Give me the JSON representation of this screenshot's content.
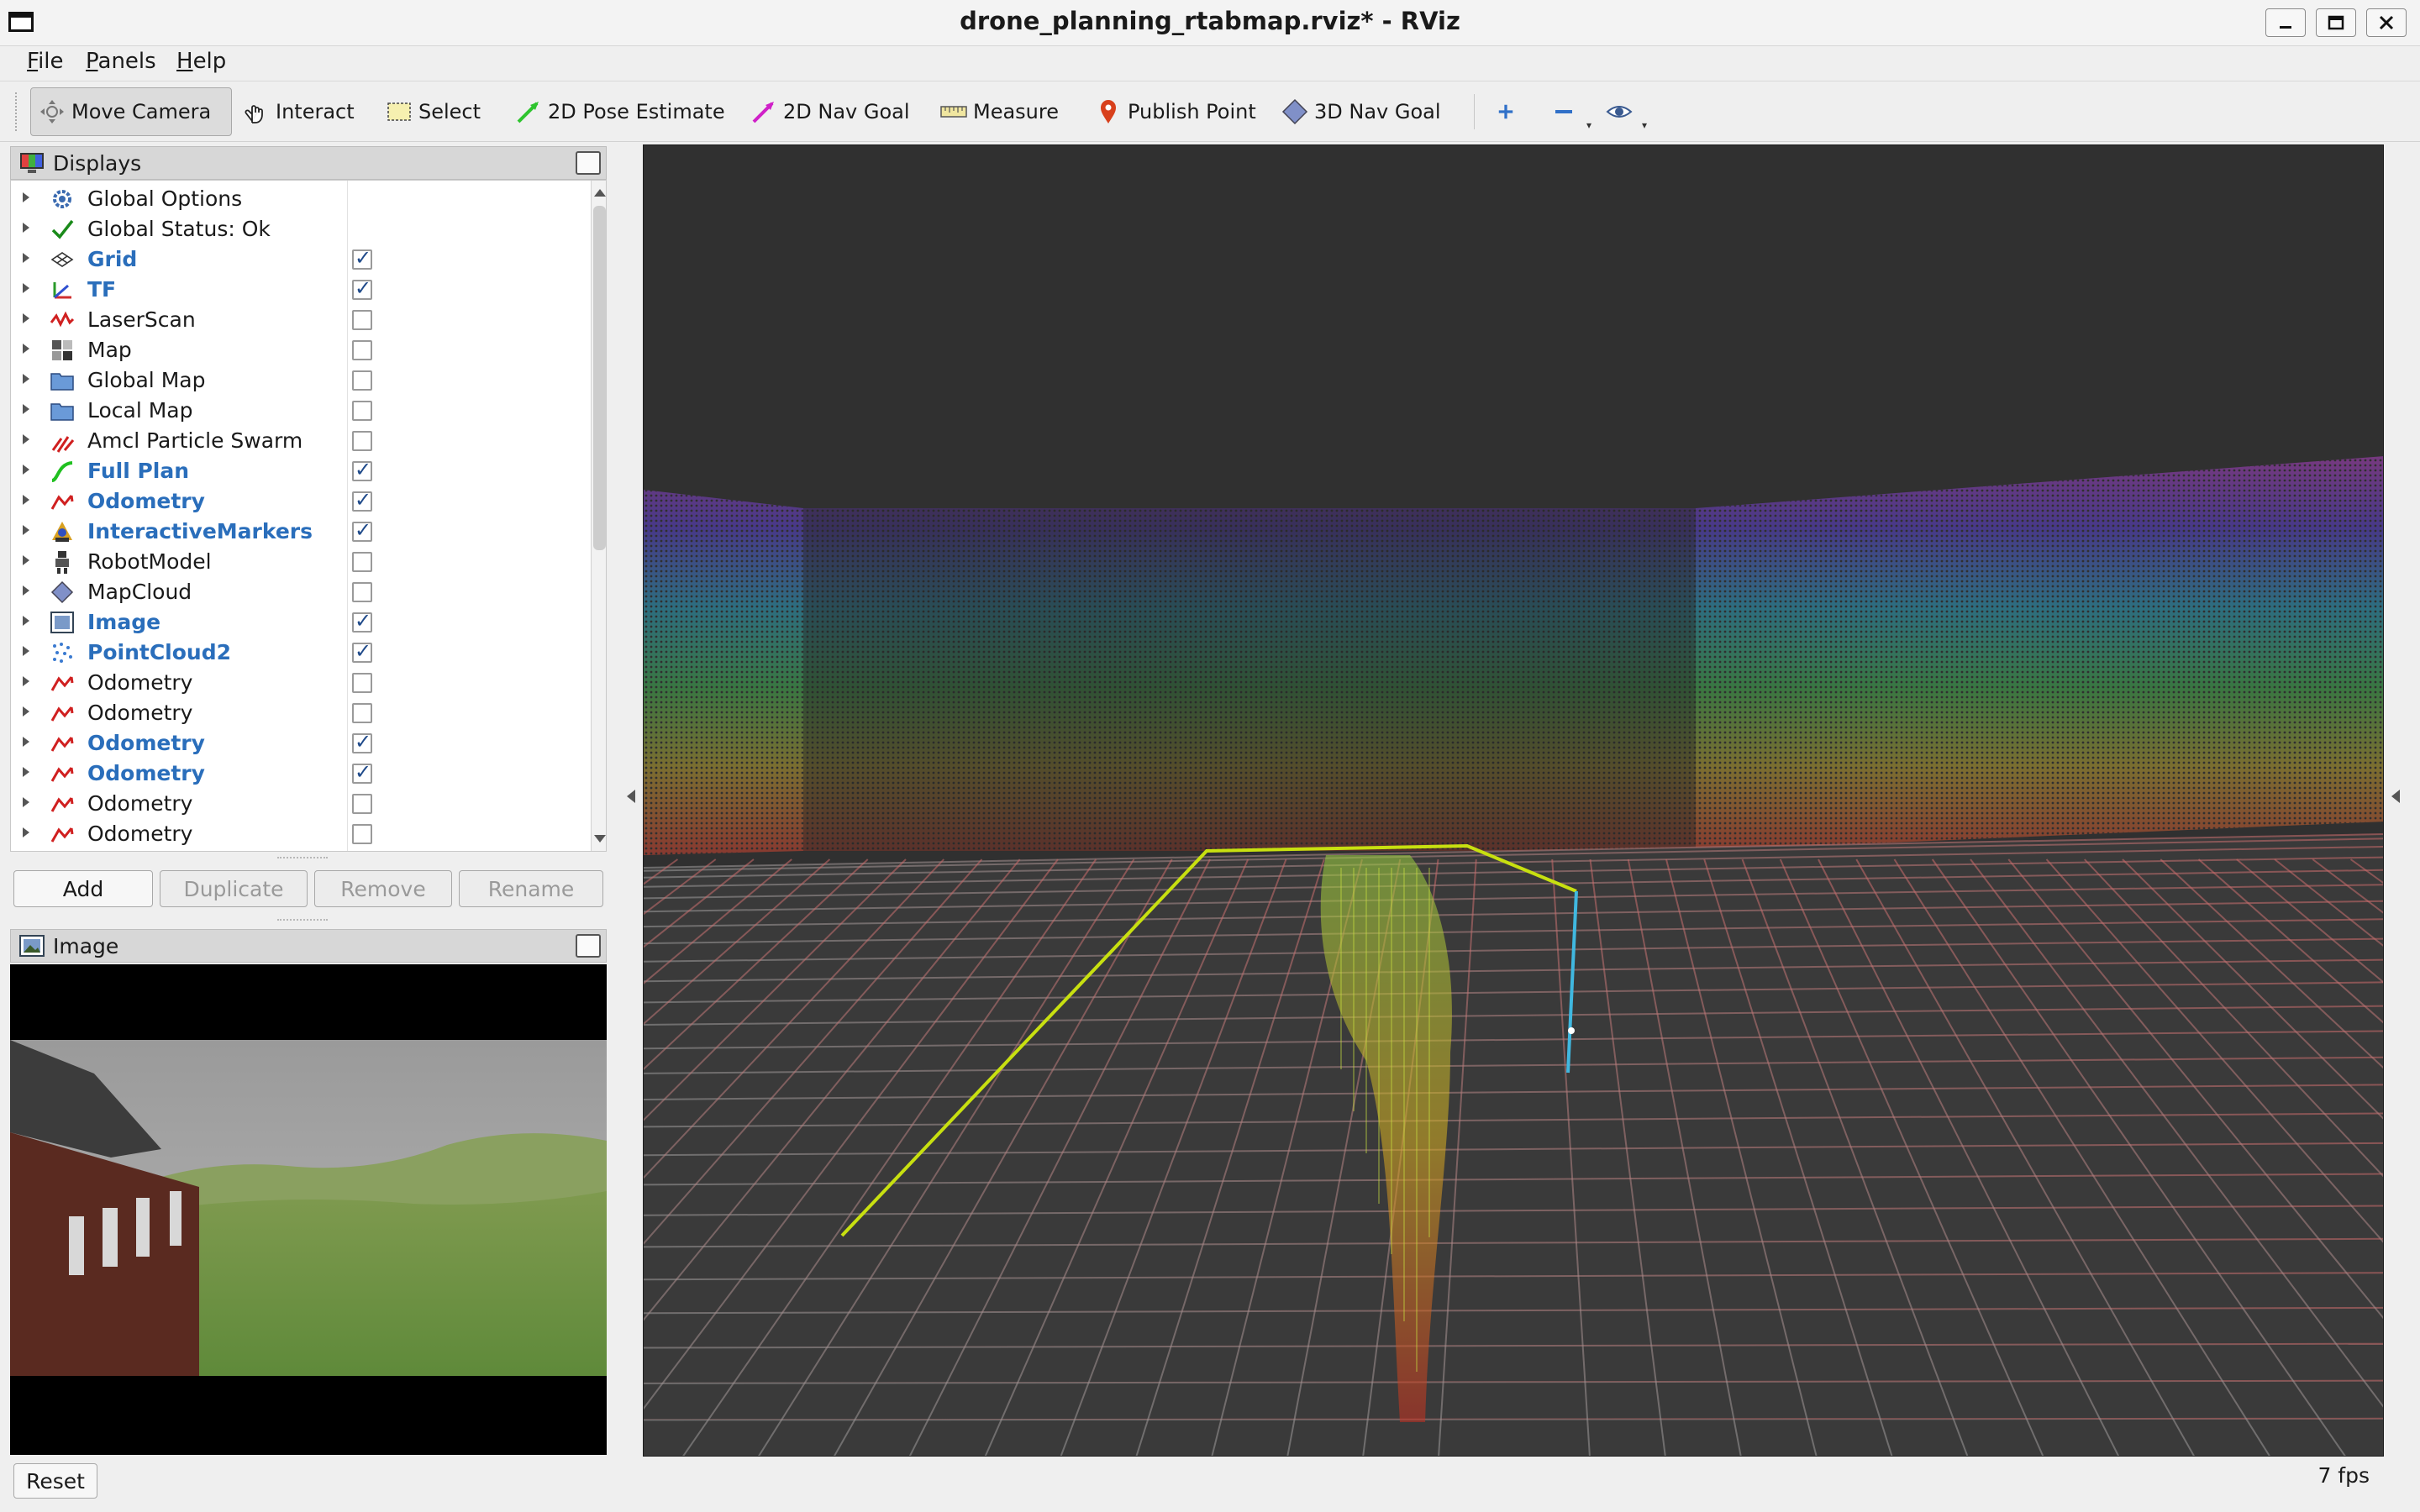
{
  "window": {
    "title": "drone_planning_rtabmap.rviz* - RViz"
  },
  "menu": [
    {
      "label": "File",
      "underline": "F",
      "rest": "ile"
    },
    {
      "label": "Panels",
      "underline": "P",
      "rest": "anels"
    },
    {
      "label": "Help",
      "underline": "H",
      "rest": "elp"
    }
  ],
  "toolbar": {
    "move_camera": "Move Camera",
    "interact": "Interact",
    "select": "Select",
    "pose_estimate": "2D Pose Estimate",
    "nav_goal": "2D Nav Goal",
    "measure": "Measure",
    "publish_point": "Publish Point",
    "nav_goal_3d": "3D Nav Goal"
  },
  "displays": {
    "title": "Displays",
    "items": [
      {
        "label": "Global Options",
        "icon": "gear-icon",
        "enabled": null,
        "highlight": false
      },
      {
        "label": "Global Status: Ok",
        "icon": "check-icon",
        "enabled": null,
        "highlight": false
      },
      {
        "label": "Grid",
        "icon": "grid-icon",
        "enabled": true,
        "highlight": true
      },
      {
        "label": "TF",
        "icon": "tf-axes-icon",
        "enabled": true,
        "highlight": true
      },
      {
        "label": "LaserScan",
        "icon": "laserscan-icon",
        "enabled": false,
        "highlight": false
      },
      {
        "label": "Map",
        "icon": "map-icon",
        "enabled": false,
        "highlight": false
      },
      {
        "label": "Global Map",
        "icon": "folder-icon",
        "enabled": false,
        "highlight": false
      },
      {
        "label": "Local Map",
        "icon": "folder-icon",
        "enabled": false,
        "highlight": false
      },
      {
        "label": "Amcl Particle Swarm",
        "icon": "particle-swarm-icon",
        "enabled": false,
        "highlight": false
      },
      {
        "label": "Full Plan",
        "icon": "path-icon",
        "enabled": true,
        "highlight": true
      },
      {
        "label": "Odometry",
        "icon": "odometry-icon",
        "enabled": true,
        "highlight": true
      },
      {
        "label": "InteractiveMarkers",
        "icon": "interactive-markers-icon",
        "enabled": true,
        "highlight": true
      },
      {
        "label": "RobotModel",
        "icon": "robot-model-icon",
        "enabled": false,
        "highlight": false
      },
      {
        "label": "MapCloud",
        "icon": "mapcloud-icon",
        "enabled": false,
        "highlight": false
      },
      {
        "label": "Image",
        "icon": "image-icon",
        "enabled": true,
        "highlight": true
      },
      {
        "label": "PointCloud2",
        "icon": "pointcloud-icon",
        "enabled": true,
        "highlight": true
      },
      {
        "label": "Odometry",
        "icon": "odometry-icon",
        "enabled": false,
        "highlight": false
      },
      {
        "label": "Odometry",
        "icon": "odometry-icon",
        "enabled": false,
        "highlight": false
      },
      {
        "label": "Odometry",
        "icon": "odometry-icon",
        "enabled": true,
        "highlight": true
      },
      {
        "label": "Odometry",
        "icon": "odometry-icon",
        "enabled": true,
        "highlight": true
      },
      {
        "label": "Odometry",
        "icon": "odometry-icon",
        "enabled": false,
        "highlight": false
      },
      {
        "label": "Odometry",
        "icon": "odometry-icon",
        "enabled": false,
        "highlight": false
      }
    ],
    "buttons": {
      "add": "Add",
      "duplicate": "Duplicate",
      "remove": "Remove",
      "rename": "Rename"
    }
  },
  "image_panel": {
    "title": "Image"
  },
  "status": {
    "reset": "Reset",
    "fps": "7 fps"
  },
  "colors": {
    "highlight_text": "#2a6ebb",
    "view_background": "#303030",
    "plan_line": "#c8e010",
    "odometry_line": "#40b8e0"
  }
}
